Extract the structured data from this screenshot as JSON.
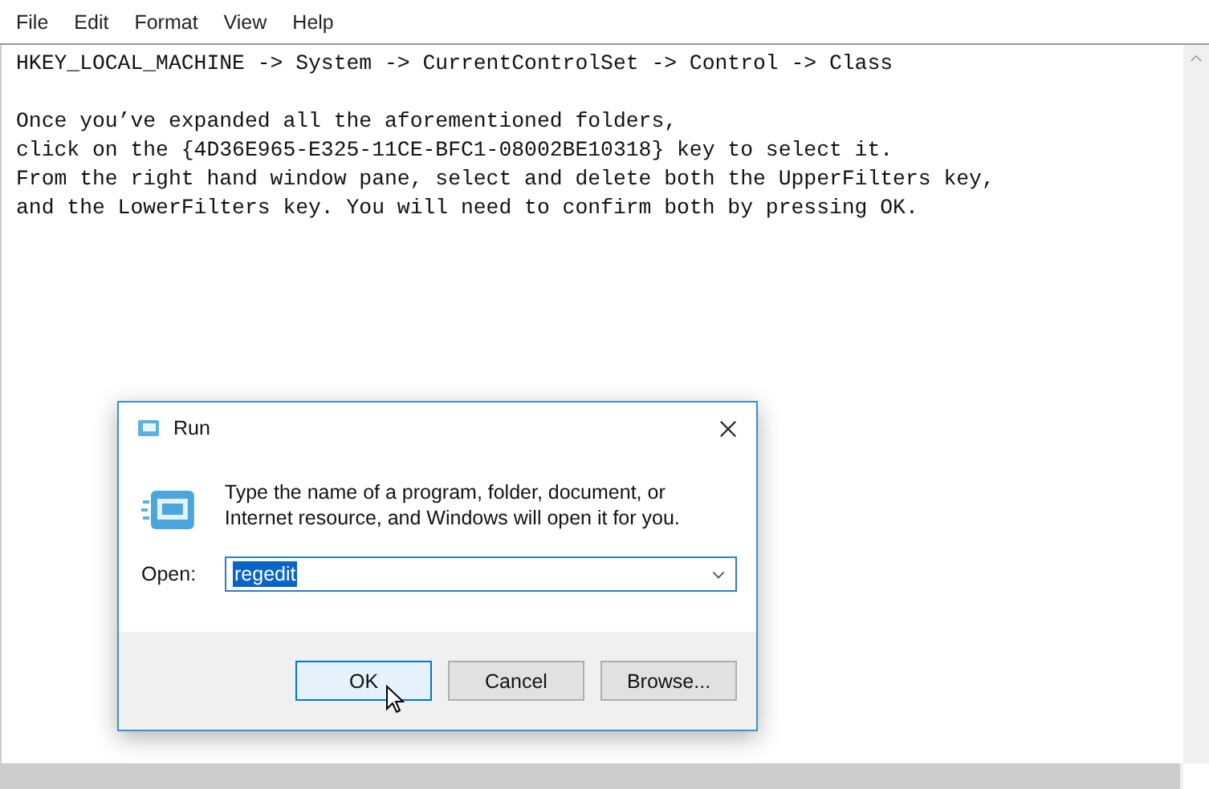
{
  "menu": [
    "File",
    "Edit",
    "Format",
    "View",
    "Help"
  ],
  "document": {
    "paragraphs": [
      [
        "HKEY_LOCAL_MACHINE -> System -> CurrentControlSet -> Control -> Class"
      ],
      [
        "Once you’ve expanded all the aforementioned folders,",
        "click on the {4D36E965-E325-11CE-BFC1-08002BE10318} key to select it.",
        "From the right hand window pane, select and delete both the UpperFilters key,",
        "and the LowerFilters key. You will need to confirm both by pressing OK."
      ]
    ]
  },
  "dialog": {
    "title": "Run",
    "description": "Type the name of a program, folder, document, or Internet resource, and Windows will open it for you.",
    "open_label": "Open:",
    "open_field": {
      "value": "regedit",
      "selected": true
    },
    "buttons": [
      {
        "label": "OK",
        "focused": true
      },
      {
        "label": "Cancel",
        "focused": false
      },
      {
        "label": "Browse...",
        "focused": false
      }
    ]
  }
}
